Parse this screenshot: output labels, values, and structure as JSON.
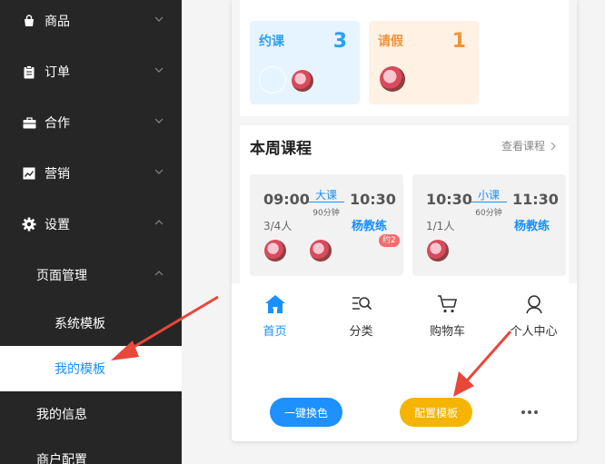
{
  "sidebar": {
    "menu": [
      {
        "label": "商品",
        "icon": "bag-icon",
        "expanded": false
      },
      {
        "label": "订单",
        "icon": "clipboard-icon",
        "expanded": false
      },
      {
        "label": "合作",
        "icon": "briefcase-icon",
        "expanded": false
      },
      {
        "label": "营销",
        "icon": "trend-chart-icon",
        "expanded": false
      },
      {
        "label": "设置",
        "icon": "gear-icon",
        "expanded": true
      }
    ],
    "sub_group": {
      "label": "页面管理",
      "expanded": true
    },
    "sub_items": [
      {
        "label": "系统模板",
        "active": false
      },
      {
        "label": "我的模板",
        "active": true
      }
    ],
    "more_items": [
      {
        "label": "我的信息"
      },
      {
        "label": "商户配置"
      }
    ]
  },
  "preview": {
    "stats": [
      {
        "label": "约课",
        "value": "3",
        "color": "#2aa0f0"
      },
      {
        "label": "请假",
        "value": "1",
        "color": "#f0933a"
      }
    ],
    "week": {
      "title": "本周课程",
      "more": "查看课程",
      "courses": [
        {
          "start": "09:00",
          "end": "10:30",
          "type": "大课",
          "duration": "90分钟",
          "count": "3/4人",
          "teacher": "杨教练",
          "badge": "约2"
        },
        {
          "start": "10:30",
          "end": "11:30",
          "type": "小课",
          "duration": "60分钟",
          "count": "1/1人",
          "teacher": "杨教练",
          "badge": ""
        }
      ]
    },
    "tabbar": [
      {
        "label": "首页",
        "icon": "home-icon",
        "active": true
      },
      {
        "label": "分类",
        "icon": "category-search-icon",
        "active": false
      },
      {
        "label": "购物车",
        "icon": "cart-icon",
        "active": false
      },
      {
        "label": "个人中心",
        "icon": "user-icon",
        "active": false
      }
    ],
    "actions": {
      "recolor": "一键换色",
      "configure": "配置模板",
      "recolor_color": "#1e90ff",
      "configure_color": "#f5b400"
    }
  },
  "colors": {
    "sidebar_bg": "#262626",
    "accent": "#1890ff",
    "arrow": "#e8473a"
  }
}
